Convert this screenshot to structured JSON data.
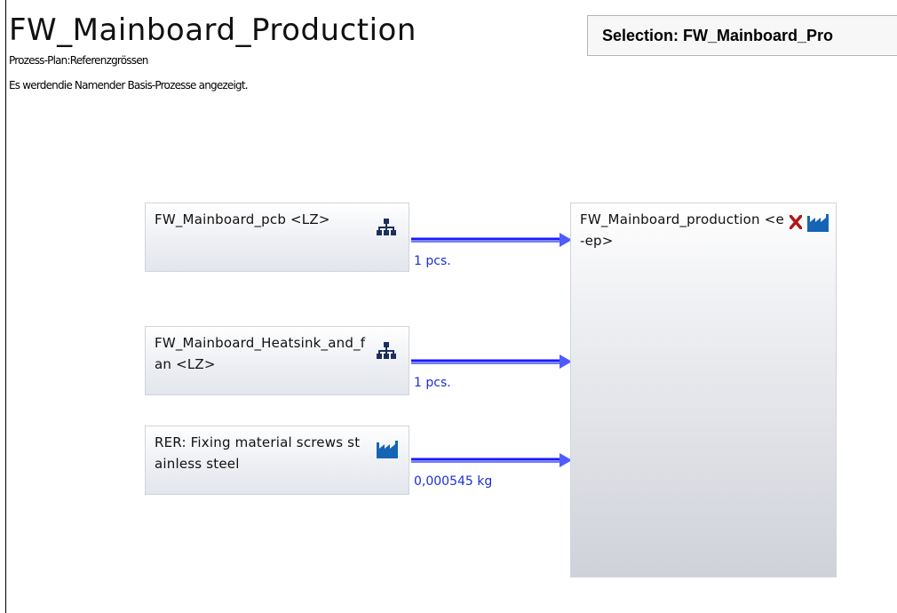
{
  "diagram": {
    "title": "FW_Mainboard_Production",
    "subtitle_line1": "Prozess-Plan:Referenzgrössen",
    "subtitle_line2": "Es werdendie Namender Basis-Prozesse angezeigt.",
    "selection_label": "Selection: FW_Mainboard_Pro",
    "nodes": [
      {
        "label": "FW_Mainboard_pcb <LZ>",
        "icon": "hierarchy-icon"
      },
      {
        "label": "FW_Mainboard_Heatsink_and_fan <LZ>",
        "icon": "hierarchy-icon"
      },
      {
        "label": "RER: Fixing material screws stainless steel",
        "icon": "factory-icon"
      }
    ],
    "target": {
      "label": "FW_Mainboard_production <e-ep>",
      "icons": [
        "delete-icon",
        "factory-icon"
      ]
    },
    "edges": [
      {
        "from": 0,
        "label": "1 pcs."
      },
      {
        "from": 1,
        "label": "1 pcs."
      },
      {
        "from": 2,
        "label": "0,000545 kg"
      }
    ],
    "colors": {
      "arrow": "#1a1aff",
      "arrow_light": "#6d7cff",
      "edge_label": "#1b2fd6",
      "icon_navy": "#1d2f5c",
      "icon_blue": "#1565b5",
      "delete_red": "#b01818"
    }
  }
}
